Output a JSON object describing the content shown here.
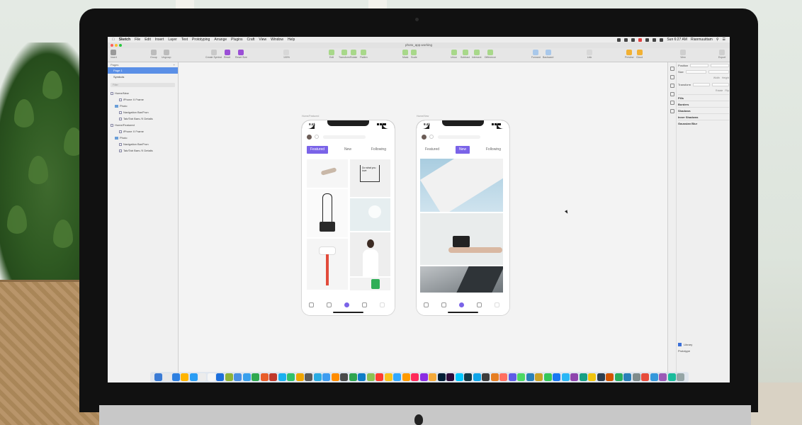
{
  "menubar": {
    "apple": "",
    "app_name": "Sketch",
    "items": [
      "File",
      "Edit",
      "Insert",
      "Layer",
      "Text",
      "Prototyping",
      "Arrange",
      "Plugins",
      "Craft",
      "View",
      "Window",
      "Help"
    ],
    "clock": "Sun 6:27 AM",
    "user": "Rianmuuittam"
  },
  "window": {
    "title": "photo_app.working"
  },
  "toolbar": {
    "insert": "Insert",
    "group": "Group",
    "ungroup": "Ungroup",
    "create_symbol": "Create Symbol",
    "reset": "Reset",
    "reset_size": "Reset Size",
    "zoom": "100%",
    "edit": "Edit",
    "transform": "Transform",
    "rotate": "Rotate",
    "flatten": "Flatten",
    "mask": "Mask",
    "scale": "Scale",
    "union": "Union",
    "subtract": "Subtract",
    "intersect": "Intersect",
    "difference": "Difference",
    "forward": "Forward",
    "backward": "Backward",
    "link": "Link",
    "preview": "Preview",
    "cloud": "Cloud",
    "view": "View",
    "export": "Export"
  },
  "pages_panel": {
    "header": "Pages",
    "pages": [
      "Page 1",
      "Symbols"
    ]
  },
  "layers_panel": {
    "filter": "Filter",
    "layers": [
      {
        "name": "Home/New",
        "indent": 0,
        "kind": "artboard"
      },
      {
        "name": "iPhone X Frame",
        "indent": 2,
        "kind": "symbol"
      },
      {
        "name": "Photo",
        "indent": 1,
        "kind": "folder"
      },
      {
        "name": "Navigation Bar/Fron",
        "indent": 2,
        "kind": "symbol"
      },
      {
        "name": "Tab/Tab Bars /X Details",
        "indent": 2,
        "kind": "symbol"
      },
      {
        "name": "Home/Featured",
        "indent": 0,
        "kind": "artboard"
      },
      {
        "name": "iPhone X Frame",
        "indent": 2,
        "kind": "symbol"
      },
      {
        "name": "Photo",
        "indent": 1,
        "kind": "folder"
      },
      {
        "name": "Navigation Bar/Fron",
        "indent": 2,
        "kind": "symbol"
      },
      {
        "name": "Tab/Tab Bars /X Details",
        "indent": 2,
        "kind": "symbol"
      }
    ]
  },
  "inspector": {
    "position": "Position",
    "size": "Size",
    "transform": "Transform",
    "width": "Width",
    "height": "Height",
    "rotate": "Rotate",
    "flip": "Flip",
    "fills": "Fills",
    "borders": "Borders",
    "shadows": "Shadows",
    "inner_shadows": "Inner Shadows",
    "gaussian_blur": "Gaussian Blur",
    "library": "Library",
    "prototype": "Prototype"
  },
  "artboards": [
    {
      "label": "Home/Featured",
      "time": "9:41",
      "tabs": [
        "Featured",
        "New",
        "Following"
      ],
      "active_tab": 0
    },
    {
      "label": "Home/New",
      "time": "9:41",
      "tabs": [
        "Featured",
        "New",
        "Following"
      ],
      "active_tab": 1
    }
  ],
  "photo_text": "Do what you love",
  "colors": {
    "accent": "#7a63e8",
    "selection": "#5a8fe6",
    "bezel": "#111111"
  },
  "dock_icon_colors": [
    "#3a7bd5",
    "#e8e8e8",
    "#2d7fe0",
    "#ffb400",
    "#2a9df4",
    "#ececec",
    "#f5f5f5",
    "#1d6fdc",
    "#8fb339",
    "#4a90e2",
    "#39a0ed",
    "#2fa84f",
    "#e85d2a",
    "#c0392b",
    "#1ab0f0",
    "#31c16b",
    "#f0a500",
    "#5b5b5b",
    "#29abe2",
    "#3d9cf0",
    "#ff8c00",
    "#4a4a4a",
    "#2ea44f",
    "#0f7cc7",
    "#8cc152",
    "#ff3b30",
    "#f7c21c",
    "#31a8ff",
    "#ff9a00",
    "#ff2a5a",
    "#8a2be2",
    "#f2a93b",
    "#001e36",
    "#2d0b3a",
    "#00c8ff",
    "#133a47",
    "#0ea5e9",
    "#3c3c3c",
    "#e67e22",
    "#ff6f61",
    "#5e5ce6",
    "#4cd964",
    "#2980b9",
    "#c9a227",
    "#34c759",
    "#1877f2",
    "#29b6f6",
    "#8e44ad",
    "#16a085",
    "#f1c40f",
    "#2c3e50",
    "#d35400",
    "#27ae60",
    "#2980b9",
    "#7f8c8d",
    "#e74c3c",
    "#3498db",
    "#9b59b6",
    "#1abc9c",
    "#95a5a6"
  ]
}
